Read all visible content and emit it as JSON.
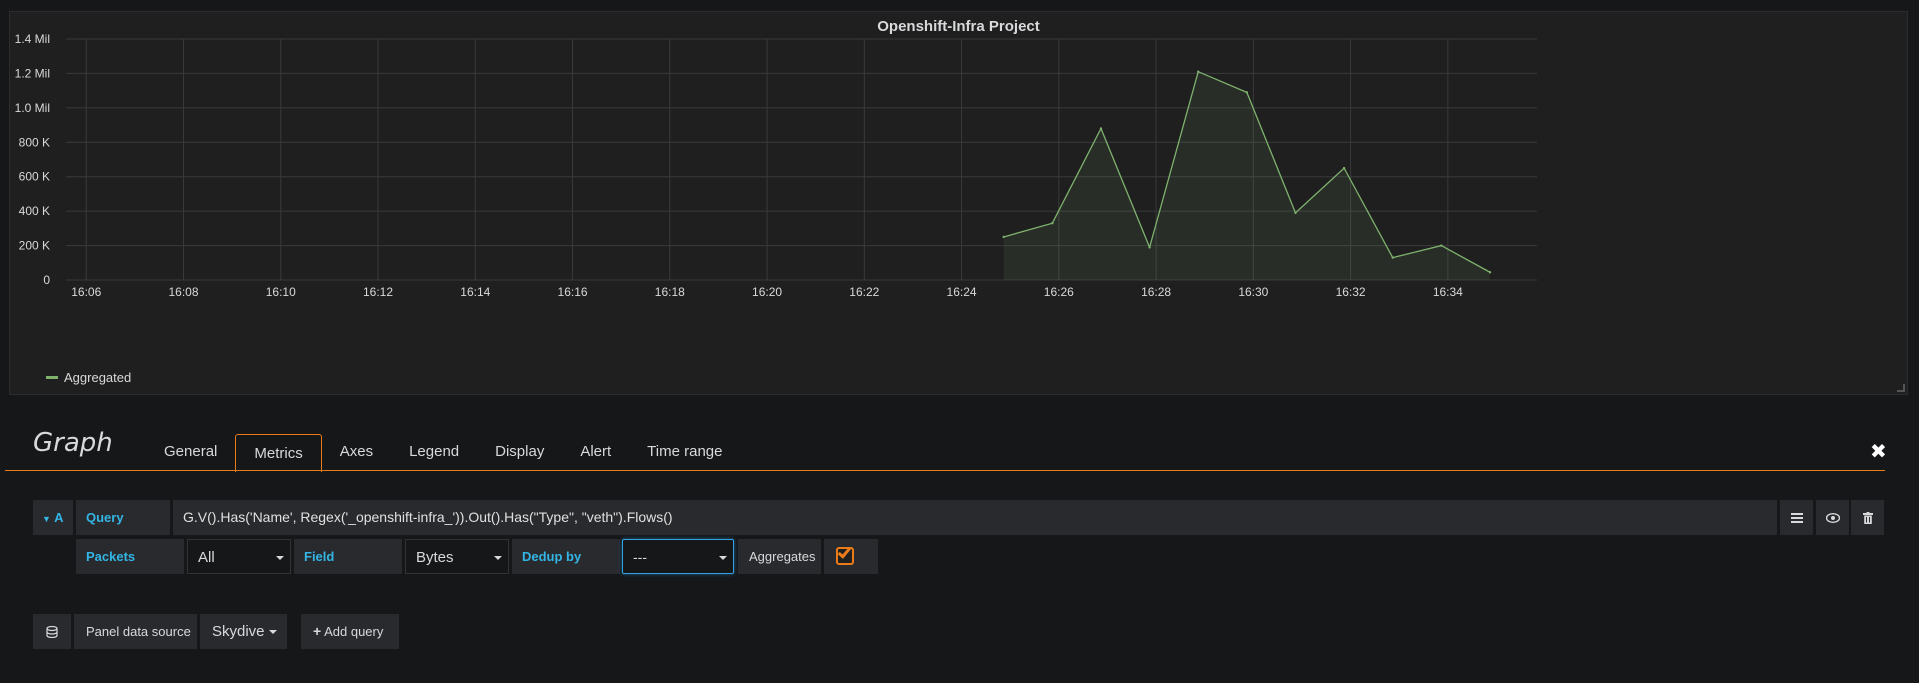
{
  "panel": {
    "title": "Openshift-Infra Project",
    "legend": "Aggregated"
  },
  "chart_data": {
    "type": "area",
    "title": "Openshift-Infra Project",
    "x_ticks": [
      "16:06",
      "16:08",
      "16:10",
      "16:12",
      "16:14",
      "16:16",
      "16:18",
      "16:20",
      "16:22",
      "16:24",
      "16:26",
      "16:28",
      "16:30",
      "16:32",
      "16:34"
    ],
    "y_ticks": [
      "0",
      "200 K",
      "400 K",
      "600 K",
      "800 K",
      "1.0 Mil",
      "1.2 Mil",
      "1.4 Mil"
    ],
    "xlim": [
      "16:05:35",
      "16:35:50"
    ],
    "ylim": [
      0,
      1400000
    ],
    "grid": true,
    "legend_position": "bottom-left",
    "series": [
      {
        "name": "Aggregated",
        "color": "#7eb26d",
        "x": [
          "16:24:52",
          "16:25:52",
          "16:26:52",
          "16:27:52",
          "16:28:52",
          "16:29:52",
          "16:30:52",
          "16:31:52",
          "16:32:52",
          "16:33:52",
          "16:34:52"
        ],
        "values": [
          250000,
          330000,
          880000,
          190000,
          1210000,
          1090000,
          390000,
          650000,
          130000,
          200000,
          45000
        ]
      }
    ]
  },
  "editor": {
    "title": "Graph",
    "tabs": [
      "General",
      "Metrics",
      "Axes",
      "Legend",
      "Display",
      "Alert",
      "Time range"
    ],
    "active_tab": "Metrics"
  },
  "query": {
    "ref": "A",
    "label": "Query",
    "value": "G.V().Has('Name', Regex('_openshift-infra_')).Out().Has(\"Type\", \"veth\").Flows()",
    "packets_label": "Packets",
    "packets_value": "All",
    "field_label": "Field",
    "field_value": "Bytes",
    "dedup_label": "Dedup by",
    "dedup_value": "---",
    "aggregates_label": "Aggregates",
    "aggregates_checked": true
  },
  "footer": {
    "panel_data_source_label": "Panel data source",
    "data_source": "Skydive",
    "add_query_label": "Add query"
  },
  "icons": {
    "ref_toggle": "caret-down-icon",
    "menu": "hamburger-icon",
    "eye": "eye-icon",
    "trash": "trash-icon",
    "database": "database-icon",
    "plus": "plus-icon",
    "close": "close-icon"
  }
}
